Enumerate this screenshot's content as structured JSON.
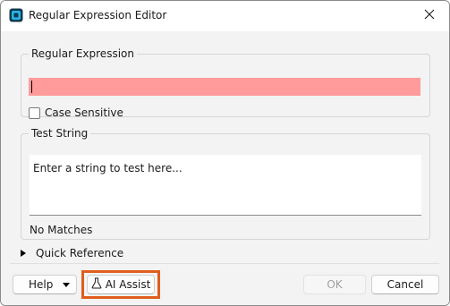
{
  "window": {
    "title": "Regular Expression Editor"
  },
  "icons": {
    "app": "regex-app-icon",
    "close": "close-icon",
    "flask": "flask-icon",
    "expand": "triangle-right-icon",
    "dropdown": "chevron-down-icon"
  },
  "regex_group": {
    "legend": "Regular Expression",
    "value": "",
    "case_sensitive_label": "Case Sensitive",
    "case_sensitive_checked": false,
    "error_color": "#ff9b9b"
  },
  "test_group": {
    "legend": "Test String",
    "placeholder": "Enter a string to test here...",
    "status": "No Matches"
  },
  "quick_reference": {
    "label": "Quick Reference",
    "expanded": false
  },
  "buttons": {
    "help": "Help",
    "ai_assist": "AI Assist",
    "ok": "OK",
    "cancel": "Cancel"
  },
  "colors": {
    "highlight": "#e05d1b",
    "app_icon": "#1f9bd6"
  }
}
